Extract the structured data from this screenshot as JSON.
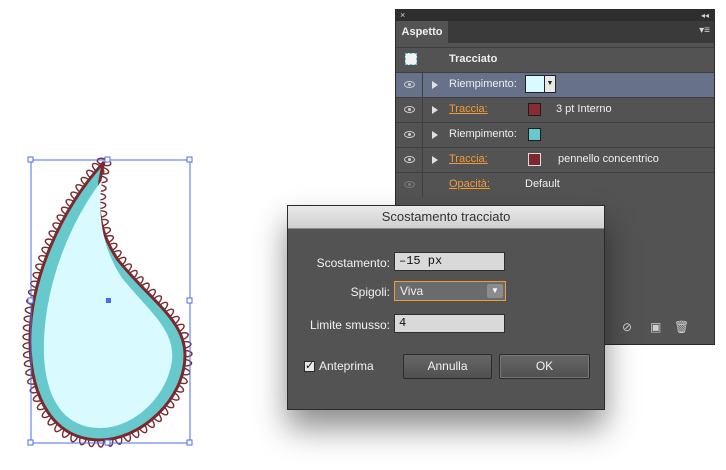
{
  "panel": {
    "title": "Aspetto",
    "close_glyph": "×",
    "collapse_glyph": "◂◂",
    "menu_glyph": "▾≡",
    "header_label": "Tracciato",
    "rows": [
      {
        "label": "Riempimento:",
        "link": false,
        "swatch": "#d9fbff",
        "selected": true,
        "value": ""
      },
      {
        "label": "Traccia:",
        "link": true,
        "swatch": "#8a2a32",
        "selected": false,
        "value": "3 pt  Interno"
      },
      {
        "label": "Riempimento:",
        "link": false,
        "swatch": "#68c9cc",
        "selected": false,
        "value": ""
      },
      {
        "label": "Traccia:",
        "link": true,
        "swatch": "#7a2a2e",
        "selected": false,
        "value": "pennello concentrico"
      },
      {
        "label": "Opacità:",
        "link": true,
        "swatch": "",
        "selected": false,
        "value": "Default"
      }
    ],
    "footer_icons": [
      "clear-icon",
      "new-item-icon",
      "trash-icon"
    ]
  },
  "dialog": {
    "title": "Scostamento tracciato",
    "offset_label": "Scostamento:",
    "offset_value": "–15 px",
    "joins_label": "Spigoli:",
    "joins_value": "Viva",
    "miter_label": "Limite smusso:",
    "miter_value": "4",
    "preview_label": "Anteprima",
    "preview_checked": true,
    "cancel_label": "Annulla",
    "ok_label": "OK"
  },
  "colors": {
    "selection": "#4a6cf0",
    "outer_stroke": "#7a2a2e",
    "teal_fill": "#68c9cc",
    "inner_fill": "#d9fbff",
    "accent_orange": "#f29a39"
  }
}
